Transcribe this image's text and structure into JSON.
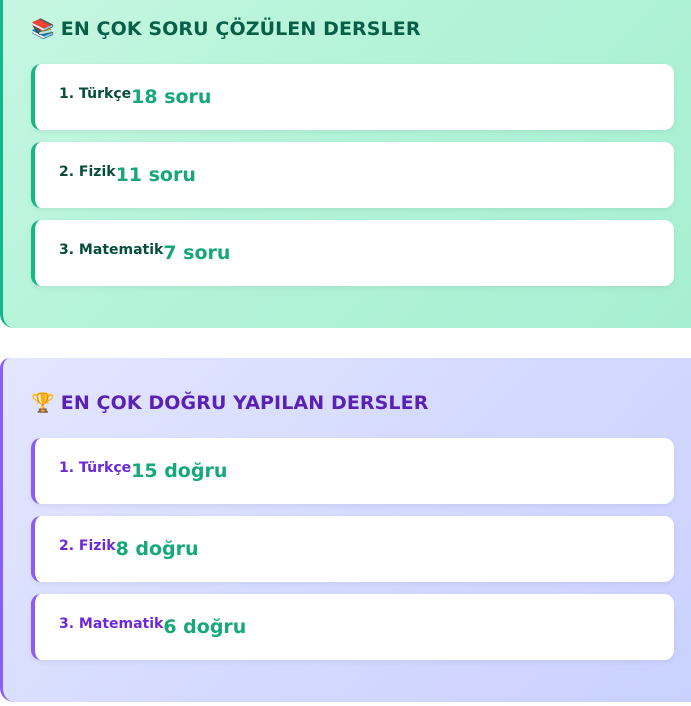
{
  "solved_section": {
    "icon": "books-icon",
    "icon_glyph": "📚",
    "title": "EN ÇOK SORU ÇÖZÜLEN DERSLER",
    "items": [
      {
        "rank_label": "1. Türkçe",
        "count_label": "18 soru"
      },
      {
        "rank_label": "2. Fizik",
        "count_label": "11 soru"
      },
      {
        "rank_label": "3. Matematik",
        "count_label": "7 soru"
      }
    ]
  },
  "correct_section": {
    "icon": "trophy-icon",
    "icon_glyph": "🏆",
    "title": "EN ÇOK DOĞRU YAPILAN DERSLER",
    "items": [
      {
        "rank_label": "1. Türkçe",
        "count_label": "15 doğru"
      },
      {
        "rank_label": "2. Fizik",
        "count_label": "8 doğru"
      },
      {
        "rank_label": "3. Matematik",
        "count_label": "6 doğru"
      }
    ]
  },
  "colors": {
    "solved_accent": "#14b884",
    "correct_accent": "#8b5cf6",
    "count_text": "#16a87a"
  }
}
